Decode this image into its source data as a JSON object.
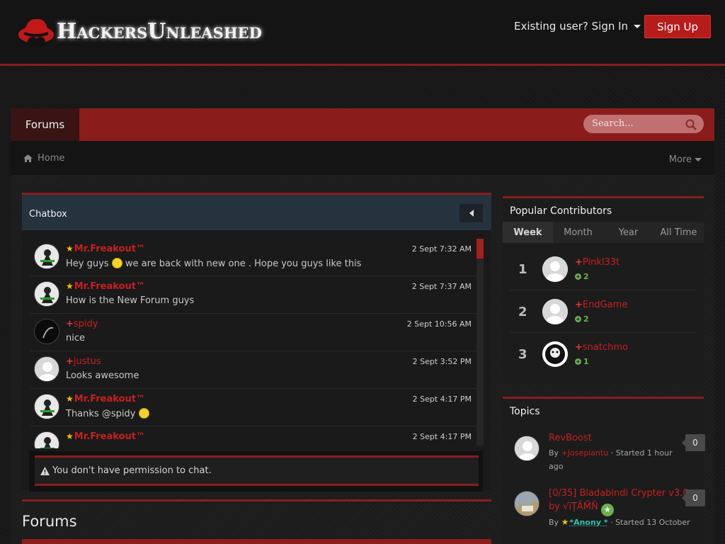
{
  "header": {
    "logo_text": "HackersUnleashed",
    "signin_label": "Existing user? Sign In",
    "signup_label": "Sign Up"
  },
  "nav": {
    "forums_tab": "Forums",
    "search_placeholder": "Search..."
  },
  "breadcrumb": {
    "home": "Home",
    "more": "More"
  },
  "chatbox": {
    "title": "Chatbox",
    "messages": [
      {
        "user": "Mr.Freakout™",
        "time": "2 Sept 7:32 AM",
        "text_before": "Hey guys",
        "text_after": "we are back with new one . Hope you guys like this",
        "smiley": "smirk"
      },
      {
        "user": "Mr.Freakout™",
        "time": "2 Sept 7:37 AM",
        "text": "How is the New Forum guys"
      },
      {
        "user": "spidy",
        "time": "2 Sept 10:56 AM",
        "text": "nice"
      },
      {
        "user": "justus",
        "time": "2 Sept 3:52 PM",
        "text": "Looks awesome"
      },
      {
        "user": "Mr.Freakout™",
        "time": "2 Sept 4:17 PM",
        "text_before": "Thanks @spidy",
        "smiley": "smile"
      },
      {
        "user": "Mr.Freakout™",
        "time": "2 Sept 4:17 PM"
      }
    ],
    "permission_notice": "You don't have permission to chat."
  },
  "forums_section": {
    "heading": "Forums"
  },
  "popular_contributors": {
    "title": "Popular Contributors",
    "tabs": [
      "Week",
      "Month",
      "Year",
      "All Time"
    ],
    "active_tab": "Week",
    "entries": [
      {
        "rank": "1",
        "name": "Pinkl33t",
        "rep": "2"
      },
      {
        "rank": "2",
        "name": "EndGame",
        "rep": "2"
      },
      {
        "rank": "3",
        "name": "snatchmo",
        "rep": "1"
      }
    ]
  },
  "topics": {
    "title": "Topics",
    "items": [
      {
        "title": "RevBoost",
        "by": "By",
        "author": "Josepiantu",
        "started": "· Started 1 hour ago",
        "count": "0"
      },
      {
        "title": "[0/35] Bladabindi Crypter v3.0 by √ïŢÃM̃Ñ",
        "by": "By",
        "author": "*Anony *",
        "started": "· Started 13 October",
        "count": "0"
      }
    ]
  },
  "colors": {
    "accent": "#8b1d1d",
    "signup": "#b71c1c",
    "username": "#c62020",
    "reputation": "#6ab04c"
  }
}
